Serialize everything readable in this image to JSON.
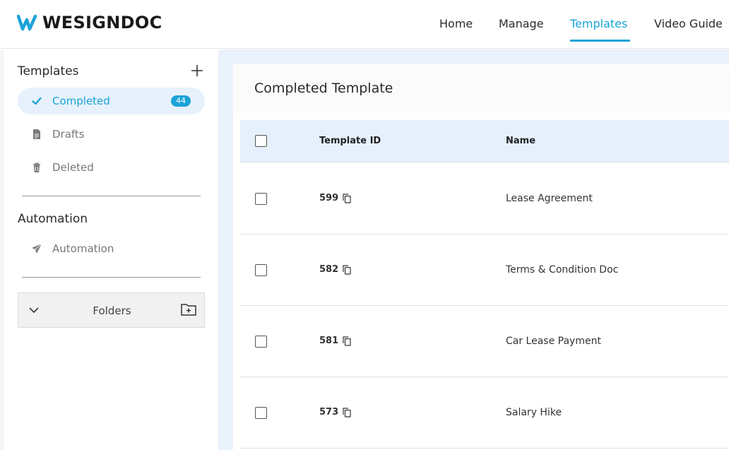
{
  "brand": {
    "name": "WESIGNDOC",
    "accent": "#1aa3d8"
  },
  "nav": {
    "items": [
      {
        "label": "Home",
        "active": false
      },
      {
        "label": "Manage",
        "active": false
      },
      {
        "label": "Templates",
        "active": true
      },
      {
        "label": "Video Guide",
        "active": false
      }
    ]
  },
  "sidebar": {
    "templates_title": "Templates",
    "items": [
      {
        "label": "Completed",
        "icon": "check-icon",
        "badge": "44",
        "active": true
      },
      {
        "label": "Drafts",
        "icon": "document-icon",
        "active": false
      },
      {
        "label": "Deleted",
        "icon": "trash-icon",
        "active": false
      }
    ],
    "automation_title": "Automation",
    "automation_items": [
      {
        "label": "Automation",
        "icon": "paper-plane-icon"
      }
    ],
    "folders_label": "Folders"
  },
  "main": {
    "title": "Completed Template",
    "columns": [
      "Template ID",
      "Name"
    ],
    "rows": [
      {
        "id": "599",
        "name": "Lease Agreement"
      },
      {
        "id": "582",
        "name": "Terms & Condition Doc"
      },
      {
        "id": "581",
        "name": "Car Lease Payment"
      },
      {
        "id": "573",
        "name": "Salary Hike"
      }
    ]
  }
}
